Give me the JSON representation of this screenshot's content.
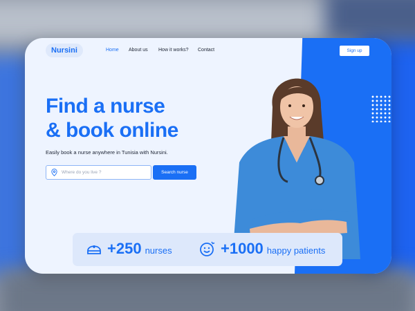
{
  "brand": {
    "name": "Nursini"
  },
  "nav": {
    "items": [
      {
        "label": "Home",
        "active": true
      },
      {
        "label": "About us",
        "active": false
      },
      {
        "label": "How it works?",
        "active": false
      },
      {
        "label": "Contact",
        "active": false
      }
    ],
    "signup_label": "Sign up"
  },
  "hero": {
    "title_line1": "Find a nurse",
    "title_line2": "& book online",
    "subtitle": "Easily book a nurse anywhere in Tunisia with Nursini."
  },
  "search": {
    "placeholder": "Where do you live ?",
    "value": "",
    "button_label": "Search nurse"
  },
  "stats": [
    {
      "icon": "nurse-cap-icon",
      "value": "+250",
      "label": "nurses"
    },
    {
      "icon": "happy-face-icon",
      "value": "+1000",
      "label": "happy patients"
    }
  ],
  "colors": {
    "accent": "#1a6ff5",
    "card_bg": "#eef4ff",
    "text": "#1d2433"
  }
}
